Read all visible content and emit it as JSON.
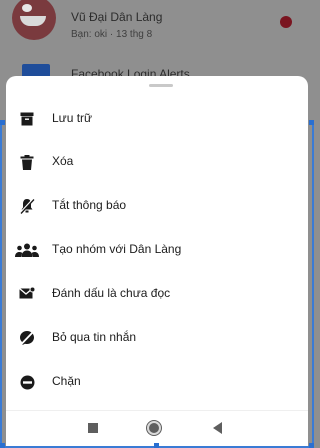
{
  "background_list": [
    {
      "name": "Vũ Đại Dân Làng",
      "subtitle": "Bạn: oki · 13 thg 8"
    },
    {
      "name": "Facebook Login Alerts"
    }
  ],
  "menu": [
    {
      "label": "Lưu trữ",
      "icon": "archive-icon"
    },
    {
      "label": "Xóa",
      "icon": "trash-icon"
    },
    {
      "label": "Tắt thông báo",
      "icon": "mute-icon"
    },
    {
      "label": "Tạo nhóm với Dân Làng",
      "icon": "group-icon"
    },
    {
      "label": "Đánh dấu là chưa đọc",
      "icon": "mark-unread-icon"
    },
    {
      "label": "Bỏ qua tin nhắn",
      "icon": "ignore-icon"
    },
    {
      "label": "Chặn",
      "icon": "block-icon"
    }
  ],
  "nav": {
    "recents": "recents-icon",
    "home": "home-icon",
    "back": "back-icon"
  },
  "colors": {
    "icon": "#1a1a1a",
    "scrim": "#8f8f8f",
    "sheet": "#ffffff",
    "selection": "#2a6fd0"
  }
}
